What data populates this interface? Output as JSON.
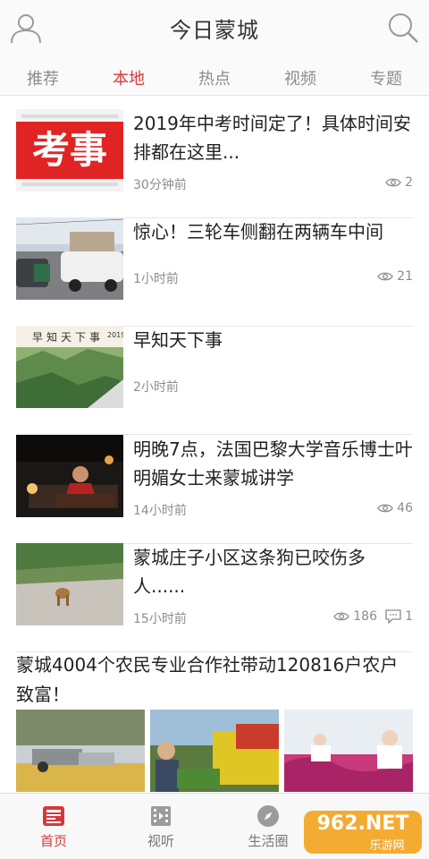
{
  "app": {
    "title": "今日蒙城"
  },
  "tabs": [
    {
      "label": "推荐",
      "active": false
    },
    {
      "label": "本地",
      "active": true
    },
    {
      "label": "热点",
      "active": false
    },
    {
      "label": "视频",
      "active": false
    },
    {
      "label": "专题",
      "active": false
    }
  ],
  "news": [
    {
      "title": "2019年中考时间定了！具体时间安排都在这里...",
      "time": "30分钟前",
      "views": "2",
      "thumb_text": "考事"
    },
    {
      "title": "惊心！三轮车侧翻在两辆车中间",
      "time": "1小时前",
      "views": "21"
    },
    {
      "title": "早知天下事",
      "time": "2小时前",
      "thumb_text": "早知天下事",
      "thumb_year": "2019"
    },
    {
      "title": "明晚7点，法国巴黎大学音乐博士叶明媚女士来蒙城讲学",
      "time": "14小时前",
      "views": "46"
    },
    {
      "title": "蒙城庄子小区这条狗已咬伤多人......",
      "time": "15小时前",
      "views": "186",
      "comments": "1"
    }
  ],
  "gallery_article": {
    "title": "蒙城4004个农民专业合作社带动120816户农户致富！"
  },
  "bottom_nav": [
    {
      "label": "首页",
      "icon": "news-icon",
      "active": true
    },
    {
      "label": "视听",
      "icon": "film-icon",
      "active": false
    },
    {
      "label": "生活圈",
      "icon": "compass-icon",
      "active": false
    }
  ],
  "watermark": {
    "text": "962.NET",
    "sub": "乐游网"
  },
  "colors": {
    "accent": "#d9383a",
    "muted": "#8c8c8c",
    "border": "#e6e6e6"
  }
}
